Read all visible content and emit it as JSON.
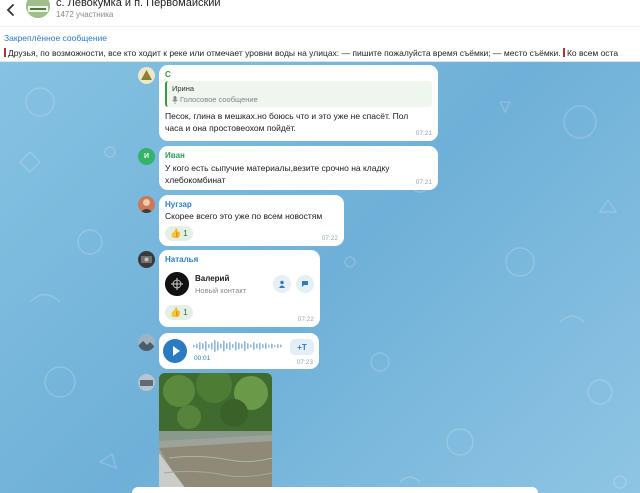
{
  "header": {
    "title": "с. Левокумка и п. Первомайский",
    "subtitle": "1472 участника"
  },
  "pinned": {
    "title": "Закреплённое сообщение",
    "text": "Друзья, по возможности, все кто ходит к реке или отмечает уровни воды на улицах: — пишите пожалуйста время съёмки; — место съёмки.",
    "text_cont": "Ко всем оста"
  },
  "messages": [
    {
      "sender": "С",
      "sender_color": "#3a9b3a",
      "reply_to": "Ирина",
      "reply_text": "Голосовое сообщение",
      "text": "Песок, глина в мешках.но боюсь что и это уже не спасёт. Пол часа и она простовеохом пойдёт.",
      "time": "07:21"
    },
    {
      "sender": "Иван",
      "avatar_letter": "И",
      "sender_color": "#2f9d5a",
      "text": "У кого есть сыпучие материалы,везите срочно на кладку хлебокомбинат",
      "time": "07:21"
    },
    {
      "sender": "Нугзар",
      "sender_color": "#2f7fc1",
      "text": "Скорее всего это уже по всем новостям",
      "reaction": "1",
      "time": "07:22"
    },
    {
      "sender": "Наталья",
      "sender_color": "#2f7fc1",
      "contact_name": "Валерий",
      "contact_sub": "Новый контакт",
      "reaction": "1",
      "time": "07:22"
    },
    {
      "voice_duration": "00:01",
      "transcribe_label": "+T",
      "time": "07:23"
    }
  ],
  "colors": {
    "accent": "#2a7bc0",
    "bubble": "#ffffff",
    "reaction_bg": "#e4efe6"
  }
}
